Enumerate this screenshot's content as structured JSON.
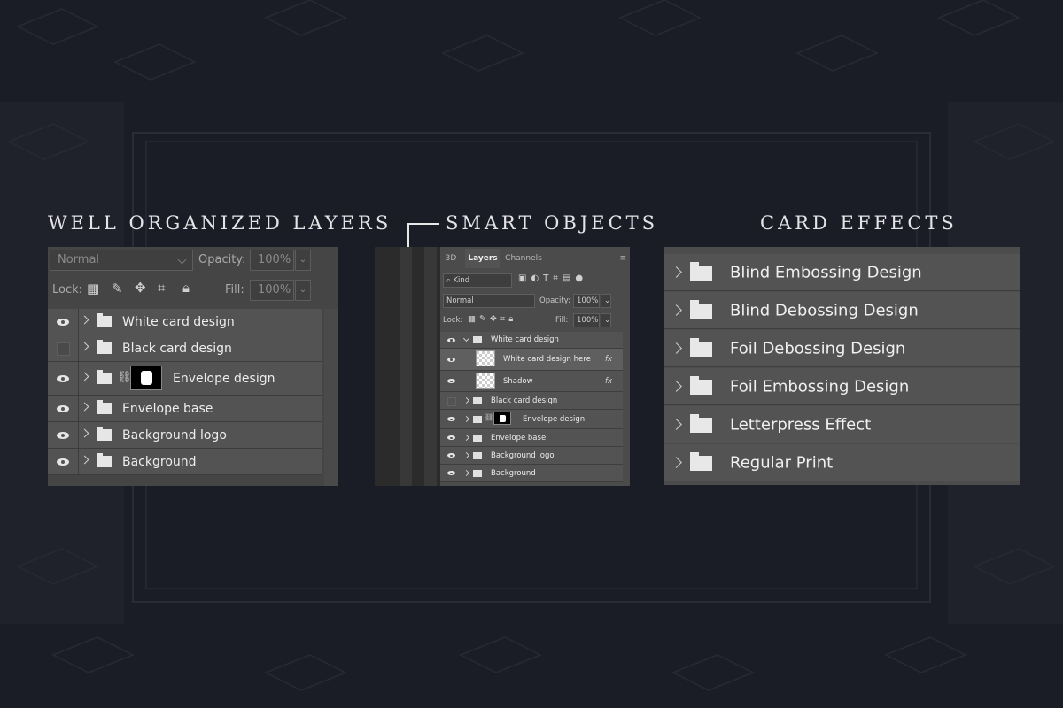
{
  "headings": {
    "layers": "WELL ORGANIZED LAYERS",
    "smart": "SMART OBJECTS",
    "effects": "CARD EFFECTS"
  },
  "panel_left": {
    "blend_mode": "Normal",
    "opacity_label": "Opacity:",
    "opacity_value": "100%",
    "lock_label": "Lock:",
    "fill_label": "Fill:",
    "fill_value": "100%",
    "layers": [
      {
        "name": "White card design",
        "visible": true
      },
      {
        "name": "Black card design",
        "visible": false
      },
      {
        "name": "Envelope design",
        "visible": true
      },
      {
        "name": "Envelope base",
        "visible": true
      },
      {
        "name": "Background logo",
        "visible": true
      },
      {
        "name": "Background",
        "visible": true
      }
    ]
  },
  "panel_mid": {
    "tabs": [
      "3D",
      "Layers",
      "Channels"
    ],
    "active_tab": "Layers",
    "filter": "Kind",
    "blend_mode": "Normal",
    "opacity_label": "Opacity:",
    "opacity_value": "100%",
    "lock_label": "Lock:",
    "fill_label": "Fill:",
    "fill_value": "100%",
    "layers": [
      {
        "name": "White card design",
        "visible": true
      },
      {
        "name": "White card design here",
        "visible": true,
        "fx": "fx"
      },
      {
        "name": "Shadow",
        "visible": true,
        "fx": "fx"
      },
      {
        "name": "Black card design",
        "visible": false
      },
      {
        "name": "Envelope design",
        "visible": true
      },
      {
        "name": "Envelope base",
        "visible": true
      },
      {
        "name": "Background logo",
        "visible": true
      },
      {
        "name": "Background",
        "visible": true
      }
    ]
  },
  "panel_right": {
    "effects": [
      "Blind Embossing Design",
      "Blind Debossing Design",
      "Foil Debossing Design",
      "Foil Embossing Design",
      "Letterpress Effect",
      "Regular Print"
    ]
  },
  "colors": {
    "background": "#1b1d26",
    "panel": "#535353",
    "text": "#ededed"
  }
}
